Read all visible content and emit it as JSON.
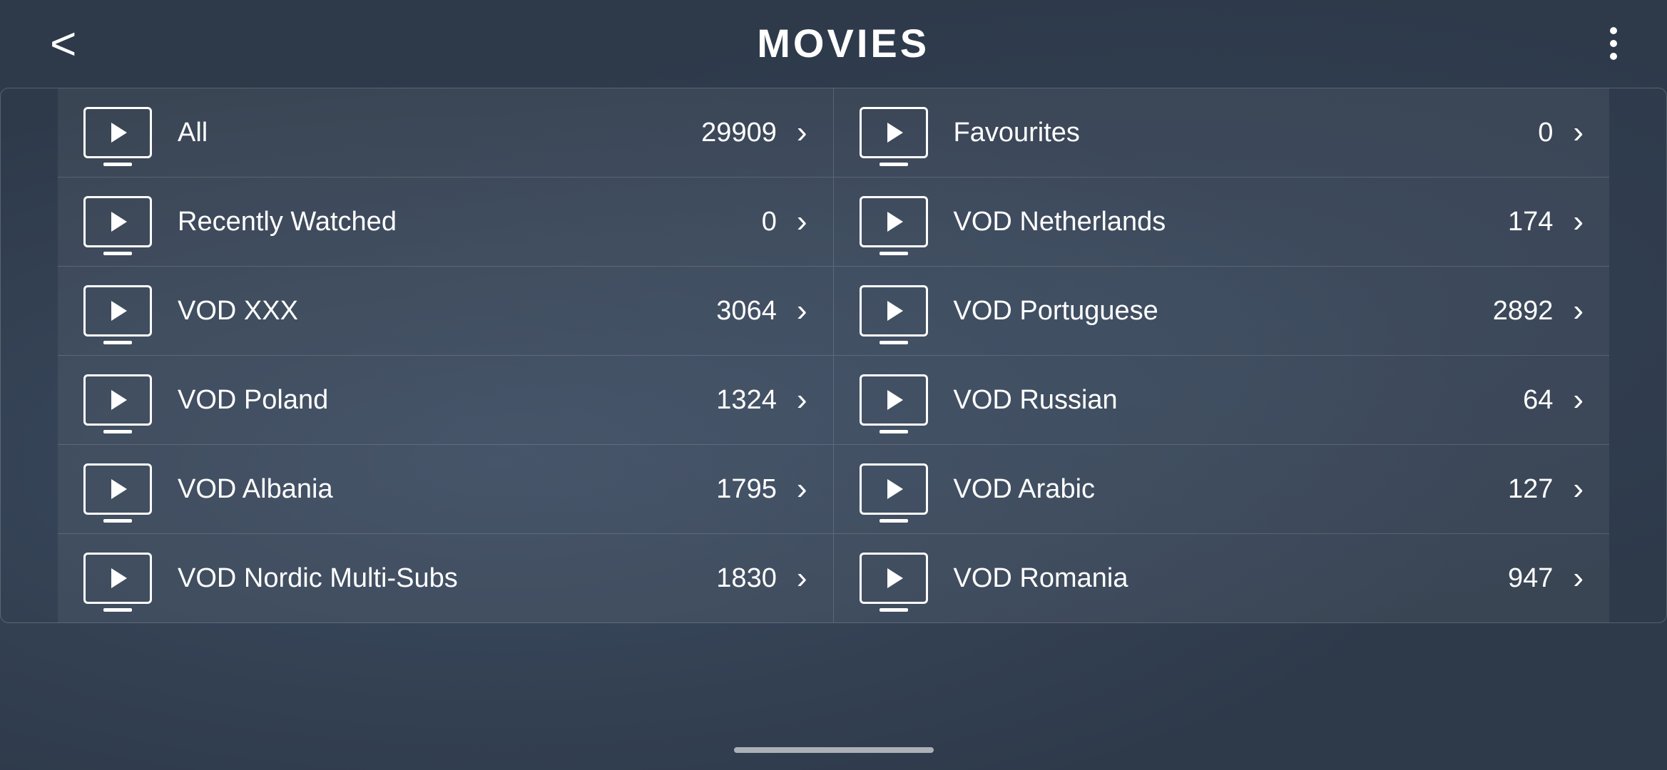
{
  "header": {
    "back_label": "<",
    "title": "MOVIES",
    "more_icon": "more-vertical-icon"
  },
  "grid": {
    "items": [
      {
        "id": "all",
        "label": "All",
        "count": "29909"
      },
      {
        "id": "favourites",
        "label": "Favourites",
        "count": "0"
      },
      {
        "id": "recently-watched",
        "label": "Recently Watched",
        "count": "0"
      },
      {
        "id": "vod-netherlands",
        "label": "VOD Netherlands",
        "count": "174"
      },
      {
        "id": "vod-xxx",
        "label": "VOD XXX",
        "count": "3064"
      },
      {
        "id": "vod-portuguese",
        "label": "VOD Portuguese",
        "count": "2892"
      },
      {
        "id": "vod-poland",
        "label": "VOD Poland",
        "count": "1324"
      },
      {
        "id": "vod-russian",
        "label": "VOD Russian",
        "count": "64"
      },
      {
        "id": "vod-albania",
        "label": "VOD Albania",
        "count": "1795"
      },
      {
        "id": "vod-arabic",
        "label": "VOD Arabic",
        "count": "127"
      },
      {
        "id": "vod-nordic",
        "label": "VOD Nordic Multi-Subs",
        "count": "1830"
      },
      {
        "id": "vod-romania",
        "label": "VOD Romania",
        "count": "947"
      }
    ]
  }
}
